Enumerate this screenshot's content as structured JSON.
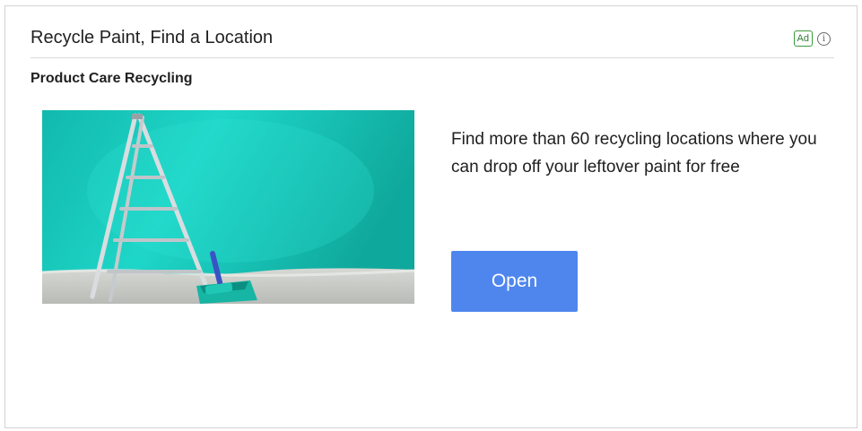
{
  "ad": {
    "headline": "Recycle Paint, Find a Location",
    "badge": "Ad",
    "advertiser": "Product Care Recycling",
    "description": "Find more than 60 recycling locations where you can drop off your leftover paint for free",
    "cta_label": "Open",
    "info_icon_glyph": "i",
    "image_subject": "ladder-and-paint-tray-against-teal-wall"
  },
  "colors": {
    "cta_background": "#4f86ee",
    "badge_green": "#3c9a3c",
    "wall_teal": "#14c2b4",
    "floor_gray": "#c9cbc8"
  }
}
